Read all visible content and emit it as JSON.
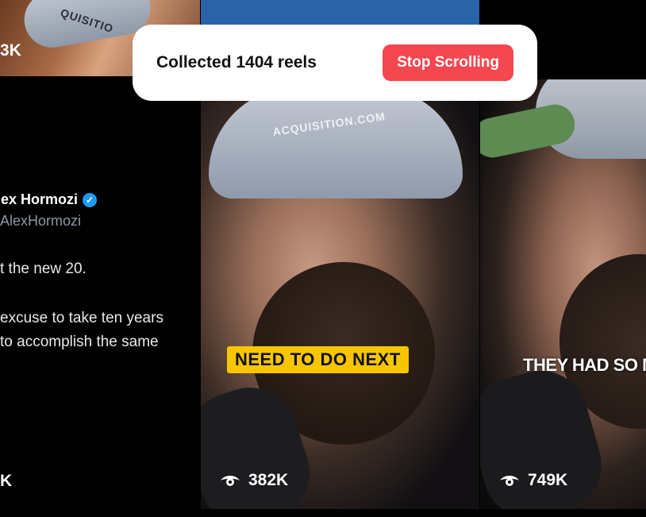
{
  "overlay": {
    "status_text": "Collected 1404 reels",
    "stop_button_label": "Stop Scrolling"
  },
  "left_column": {
    "top_thumb_count": "3K",
    "top_thumb_cap_text": "QUISITIO",
    "tweet": {
      "author": "lex Hormozi",
      "handle": "AlexHormozi",
      "lines": [
        "t the new 20.",
        "excuse to take ten years",
        "to accomplish the same"
      ]
    },
    "bottom_count": "K"
  },
  "middle_reel": {
    "cap_text": "ACQUISITION.COM",
    "caption": "NEED TO DO NEXT",
    "views": "382K"
  },
  "right_reel": {
    "caption": "THEY HAD SO MUC",
    "views": "749K"
  },
  "colors": {
    "stop_button": "#f4474f",
    "caption_yellow": "#f7c600",
    "verified": "#1d9bf0"
  }
}
